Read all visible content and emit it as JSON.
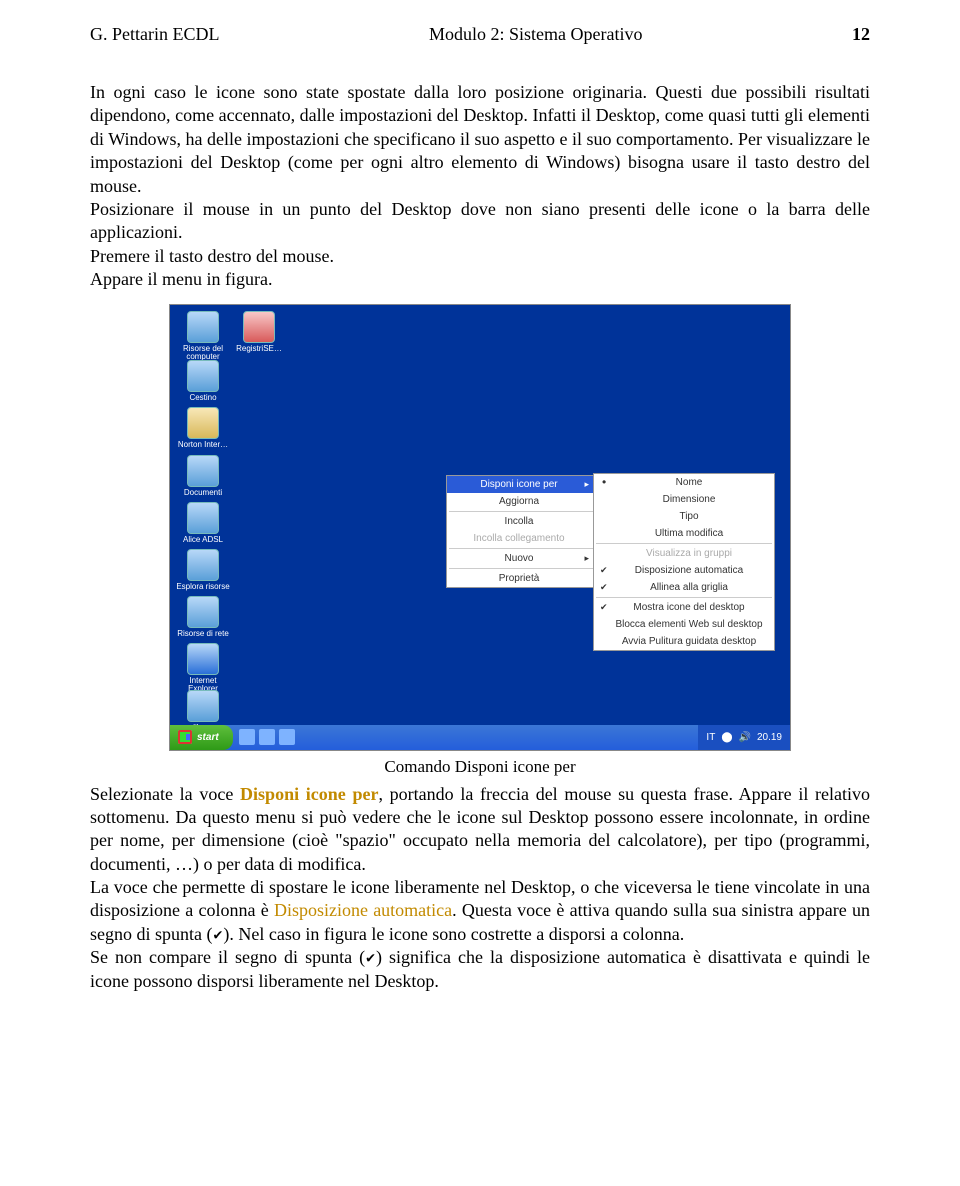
{
  "header": {
    "author": "G. Pettarin ECDL",
    "title": "Modulo 2: Sistema Operativo",
    "page": "12"
  },
  "para1": "In ogni caso le icone sono state spostate dalla loro posizione originaria. Questi due possibili risultati dipendono, come accennato, dalle impostazioni del Desktop. Infatti il Desktop, come quasi tutti gli elementi di Windows, ha delle impostazioni che specificano il suo aspetto e il suo comportamento. Per visualizzare le impostazioni del Desktop (come per ogni altro elemento di Windows) bisogna usare il tasto destro del mouse.",
  "para2": "Posizionare il mouse in un punto del Desktop dove non siano presenti delle icone o la barra delle applicazioni.",
  "para3": "Premere il tasto destro del mouse.",
  "para4": "Appare il menu in figura.",
  "icons": {
    "risorse": "Risorse del computer",
    "registri": "RegistriSE…",
    "cestino": "Cestino",
    "norton": "Norton Inter…",
    "documenti": "Documenti",
    "alice": "Alice ADSL",
    "esplora": "Esplora risorse",
    "rete": "Risorse di rete",
    "ie": "Internet Explorer",
    "libero": "libero"
  },
  "ctx": {
    "disponi": "Disponi icone per",
    "aggiorna": "Aggiorna",
    "incolla": "Incolla",
    "incollacol": "Incolla collegamento",
    "nuovo": "Nuovo",
    "proprieta": "Proprietà"
  },
  "sub": {
    "nome": "Nome",
    "dim": "Dimensione",
    "tipo": "Tipo",
    "ultima": "Ultima modifica",
    "gruppi": "Visualizza in gruppi",
    "dispauto": "Disposizione automatica",
    "griglia": "Allinea alla griglia",
    "mostra": "Mostra icone del desktop",
    "blocca": "Blocca elementi Web sul desktop",
    "pulitura": "Avvia Pulitura guidata desktop"
  },
  "taskbar": {
    "start": "start",
    "lang": "IT",
    "clock": "20.19"
  },
  "caption": "Comando Disponi icone per",
  "seg": {
    "a1": "Selezionate la voce ",
    "a2": "Disponi icone per",
    "a3": ", portando la freccia del mouse su questa frase. Appare il relativo sottomenu. Da questo menu si può vedere che le icone sul Desktop possono essere incolonnate, in ordine per nome, per dimensione (cioè \"spazio\" occupato nella memoria del calcolatore), per tipo (programmi, documenti, …) o per data di modifica.",
    "b1": "La voce che permette di spostare le icone liberamente nel Desktop, o che viceversa le tiene vincolate in una disposizione a colonna è ",
    "b2": "Disposizione automatica",
    "b3": ". Questa voce è attiva quando sulla sua sinistra appare un segno di spunta (",
    "b4": "). Nel caso in figura le icone sono costrette a disporsi a colonna.",
    "c1": "Se non compare il segno di spunta (",
    "c2": ") significa che la disposizione automatica è disattivata e quindi le icone possono disporsi liberamente nel Desktop."
  }
}
